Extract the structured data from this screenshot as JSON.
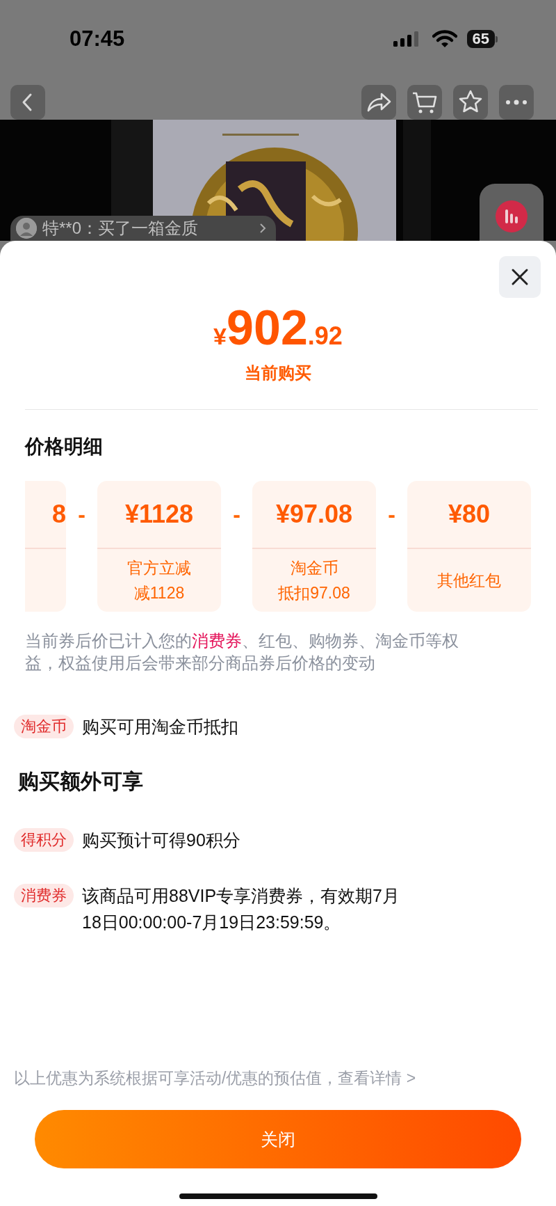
{
  "status_bar": {
    "time": "07:45",
    "battery": "65"
  },
  "nav": {
    "buttons": [
      {
        "kind": "back"
      },
      {
        "kind": "share"
      },
      {
        "kind": "cart"
      },
      {
        "kind": "favorite"
      },
      {
        "kind": "more"
      }
    ]
  },
  "media": {
    "kind": "picture",
    "comment": "特**0：买了一箱金质"
  },
  "sheet": {
    "price": {
      "currency": "¥",
      "integer": "902",
      "decimal": ".92",
      "caption": "当前购买"
    },
    "section_title": "价格明细",
    "breakdown": [
      {
        "kind": "partial",
        "value": "8"
      },
      {
        "kind": "full",
        "operator": "-",
        "value": "¥1128",
        "label": [
          "官方立减",
          "减1128"
        ]
      },
      {
        "kind": "full",
        "operator": "-",
        "value": "¥97.08",
        "label": [
          "淘金币",
          "抵扣97.08"
        ]
      },
      {
        "kind": "full",
        "operator": "-",
        "value": "¥80",
        "label": [
          "其他红包"
        ]
      }
    ],
    "note": [
      {
        "text": "当前券后价已计入您的",
        "highlight": false
      },
      {
        "text": "消费券",
        "highlight": true
      },
      {
        "text": "、红包、购物券、淘金币等权益，权益使用后会带来部分商品券后价格的变动",
        "highlight": false
      }
    ],
    "benefits": [
      {
        "tag": "淘金币",
        "text": "购买可用淘金币抵扣"
      }
    ],
    "extra_title": "购买额外可享",
    "extras": [
      {
        "tag": "得积分",
        "text": "购买预计可得90积分"
      },
      {
        "tag": "消费券",
        "text": "该商品可用88VIP专享消费券，有效期7月18日00:00:00-7月19日23:59:59。"
      }
    ],
    "footer": {
      "text": "以上优惠为系统根据可享活动/优惠的预估值，",
      "link": "查看详情 >"
    },
    "close_button": "关闭"
  }
}
